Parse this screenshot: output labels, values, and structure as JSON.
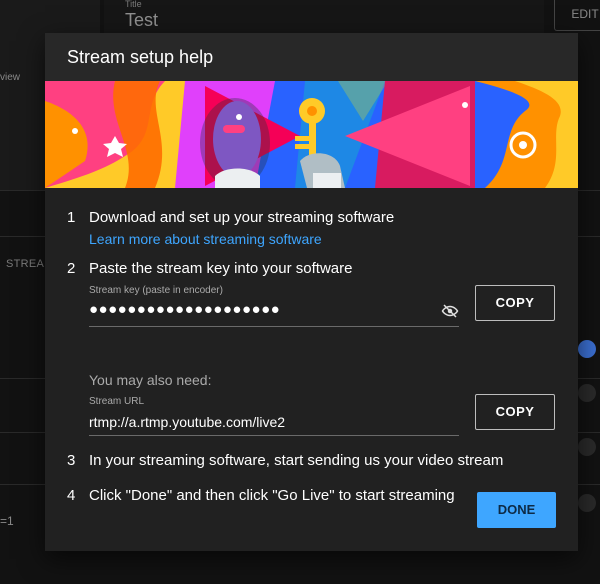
{
  "background": {
    "preview_text": "view",
    "title_label": "Title",
    "title_value": "Test",
    "edit_button": "EDIT",
    "section_label": "STREA",
    "param_text": "=1"
  },
  "modal": {
    "title": "Stream setup help",
    "steps": [
      {
        "num": "1",
        "text": "Download and set up your streaming software",
        "link": "Learn more about streaming software"
      },
      {
        "num": "2",
        "text": "Paste the stream key into your software"
      },
      {
        "num": "3",
        "text": "In your streaming software, start sending us your video stream"
      },
      {
        "num": "4",
        "text": "Click \"Done\" and then click \"Go Live\" to start streaming"
      }
    ],
    "stream_key": {
      "label": "Stream key (paste in encoder)",
      "value": "●●●●●●●●●●●●●●●●●●●●",
      "copy_label": "COPY"
    },
    "also_need": "You may also need:",
    "stream_url": {
      "label": "Stream URL",
      "value": "rtmp://a.rtmp.youtube.com/live2",
      "copy_label": "COPY"
    },
    "done_label": "DONE",
    "colors": {
      "accent": "#3ea6ff",
      "surface": "#212121",
      "header": "#282828"
    }
  }
}
